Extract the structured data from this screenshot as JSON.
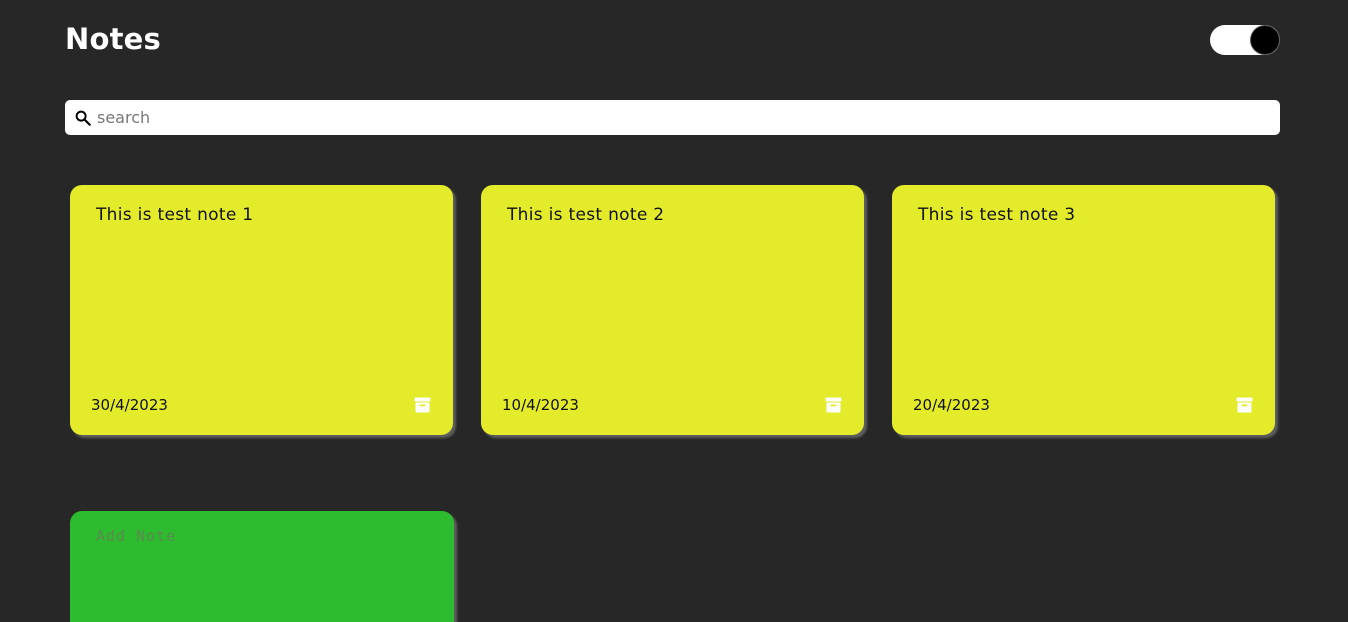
{
  "header": {
    "title": "Notes",
    "theme_toggle": {
      "state": "on"
    }
  },
  "search": {
    "placeholder": "search",
    "value": ""
  },
  "notes": [
    {
      "text": "This is test note 1",
      "date": "30/4/2023"
    },
    {
      "text": "This is test note 2",
      "date": "10/4/2023"
    },
    {
      "text": "This is test note 3",
      "date": "20/4/2023"
    }
  ],
  "add_note": {
    "placeholder": "Add Note"
  },
  "colors": {
    "background": "#282727",
    "note": "#e3eb2b",
    "add_note": "#2dbb2f",
    "text": "#111111"
  },
  "icons": {
    "search": "search-icon",
    "archive": "archive-icon"
  }
}
